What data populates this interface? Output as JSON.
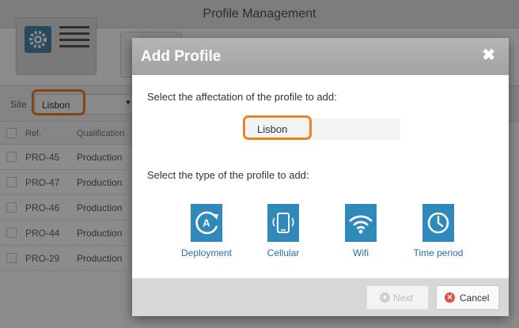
{
  "app": {
    "title": "Profile Management",
    "site_label": "Site",
    "site_value": "Lisbon"
  },
  "table": {
    "headers": [
      "Ref.",
      "Qualification"
    ],
    "rows": [
      {
        "ref": "PRO-45",
        "qualification": "Production"
      },
      {
        "ref": "PRO-47",
        "qualification": "Production"
      },
      {
        "ref": "PRO-46",
        "qualification": "Production"
      },
      {
        "ref": "PRO-44",
        "qualification": "Production"
      },
      {
        "ref": "PRO-29",
        "qualification": "Production"
      }
    ]
  },
  "modal": {
    "title": "Add Profile",
    "close_glyph": "✖",
    "affectation_prompt": "Select the affectation of the profile to add:",
    "affectation_value": "Lisbon",
    "type_prompt": "Select the type of the profile to add:",
    "types": [
      {
        "label": "Deployment",
        "icon": "deployment-icon"
      },
      {
        "label": "Cellular",
        "icon": "smartphone-icon"
      },
      {
        "label": "Wifi",
        "icon": "wifi-icon"
      },
      {
        "label": "Time period",
        "icon": "clock-icon"
      }
    ],
    "next_label": "Next",
    "cancel_label": "Cancel"
  },
  "colors": {
    "accent": "#2f8abb",
    "highlight": "#f07f22",
    "cancel": "#d9534f"
  }
}
